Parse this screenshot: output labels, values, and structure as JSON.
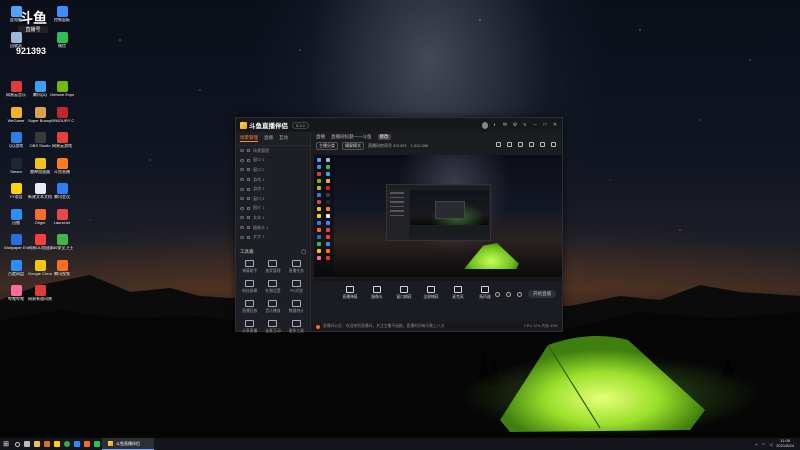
{
  "desktop": {
    "badge": {
      "big": "斗鱼",
      "small": "直播号",
      "number": "921393"
    },
    "icons": [
      {
        "label": "此电脑",
        "color": "#4da3ff"
      },
      {
        "label": "回收站",
        "color": "#9fb8d8"
      },
      {
        "label": "控制面板",
        "color": "#3f8cff"
      },
      {
        "label": "微信",
        "color": "#2bc058"
      },
      {
        "label": "网易云音乐",
        "color": "#e03b3b"
      },
      {
        "label": "腾讯QQ",
        "color": "#38a1f3"
      },
      {
        "label": "Geforce Experience",
        "color": "#76b900"
      },
      {
        "label": "WeGame",
        "color": "#f4b324"
      },
      {
        "label": "Super Bunny Man",
        "color": "#d9a24b"
      },
      {
        "label": "ARMOURY CRATE",
        "color": "#c0262c"
      },
      {
        "label": "QQ游戏",
        "color": "#2d7fe6"
      },
      {
        "label": "OBS Studio",
        "color": "#3a3a3a"
      },
      {
        "label": "网易云游戏",
        "color": "#e2413a"
      },
      {
        "label": "Steam",
        "color": "#1b2838"
      },
      {
        "label": "雷神加速器",
        "color": "#f0c419"
      },
      {
        "label": "斗鱼直播",
        "color": "#ff7a1a"
      },
      {
        "label": "YY语音",
        "color": "#ffd400"
      },
      {
        "label": "新建文本文档",
        "color": "#e9ecf2"
      },
      {
        "label": "腾讯会议",
        "color": "#2e7df6"
      },
      {
        "label": "迅雷",
        "color": "#2b8ffd"
      },
      {
        "label": "Origin",
        "color": "#f56c2d"
      },
      {
        "label": "Launcher",
        "color": "#e64848"
      },
      {
        "label": "Wallpaper Engine",
        "color": "#2d6cdf"
      },
      {
        "label": "网易UU加速器",
        "color": "#ff3d3d"
      },
      {
        "label": "360安全卫士",
        "color": "#44b549"
      },
      {
        "label": "百度网盘",
        "color": "#2e8cff"
      },
      {
        "label": "Google Chrome",
        "color": "#f3c613"
      },
      {
        "label": "腾讯视频",
        "color": "#ff6d1f"
      },
      {
        "label": "哔哩哔哩",
        "color": "#ff6aa0"
      },
      {
        "label": "网易有道词典",
        "color": "#e23a3a"
      }
    ]
  },
  "app": {
    "title": "斗鱼直播伴侣",
    "version": "5.3.2",
    "left_tabs": [
      "场景管理",
      "直播",
      "互动"
    ],
    "scenes": [
      "场景管理",
      "窗口 1",
      "窗口 2",
      "游戏 1",
      "游戏 2",
      "窗口 3",
      "图片 1",
      "文本 1",
      "摄像头 1",
      "文字 1"
    ],
    "tools_title": "工具箱",
    "tools": [
      "弹幕助手",
      "抽奖管理",
      "直播任务",
      "粉丝勋章",
      "礼物设置",
      "PK对战",
      "直播回放",
      "音乐播放",
      "数据统计",
      "分享直播",
      "连麦互动",
      "更多工具"
    ],
    "main_tabs": {
      "tab1": "直播",
      "tab2": "直播间标题——斗鱼",
      "pill": "修改"
    },
    "main_sub": {
      "channel": "主播分类",
      "mode": "横屏模式",
      "extra": "直播间房间号 921393",
      "fans": "1,512,096"
    },
    "controls": [
      "直播弹幕",
      "摄像头",
      "窗口捕获",
      "全屏捕获",
      "麦克风",
      "扬声器"
    ],
    "start_label": "开始直播",
    "status_text": "直播间公告：欢迎来到直播间，关注主播不迷路，直播时间每天晚上八点",
    "status_right": "CPU 12%  内存 45%"
  },
  "taskbar": {
    "active_app": "斗鱼直播伴侣",
    "time": "11:08",
    "date": "2021/8/24"
  }
}
